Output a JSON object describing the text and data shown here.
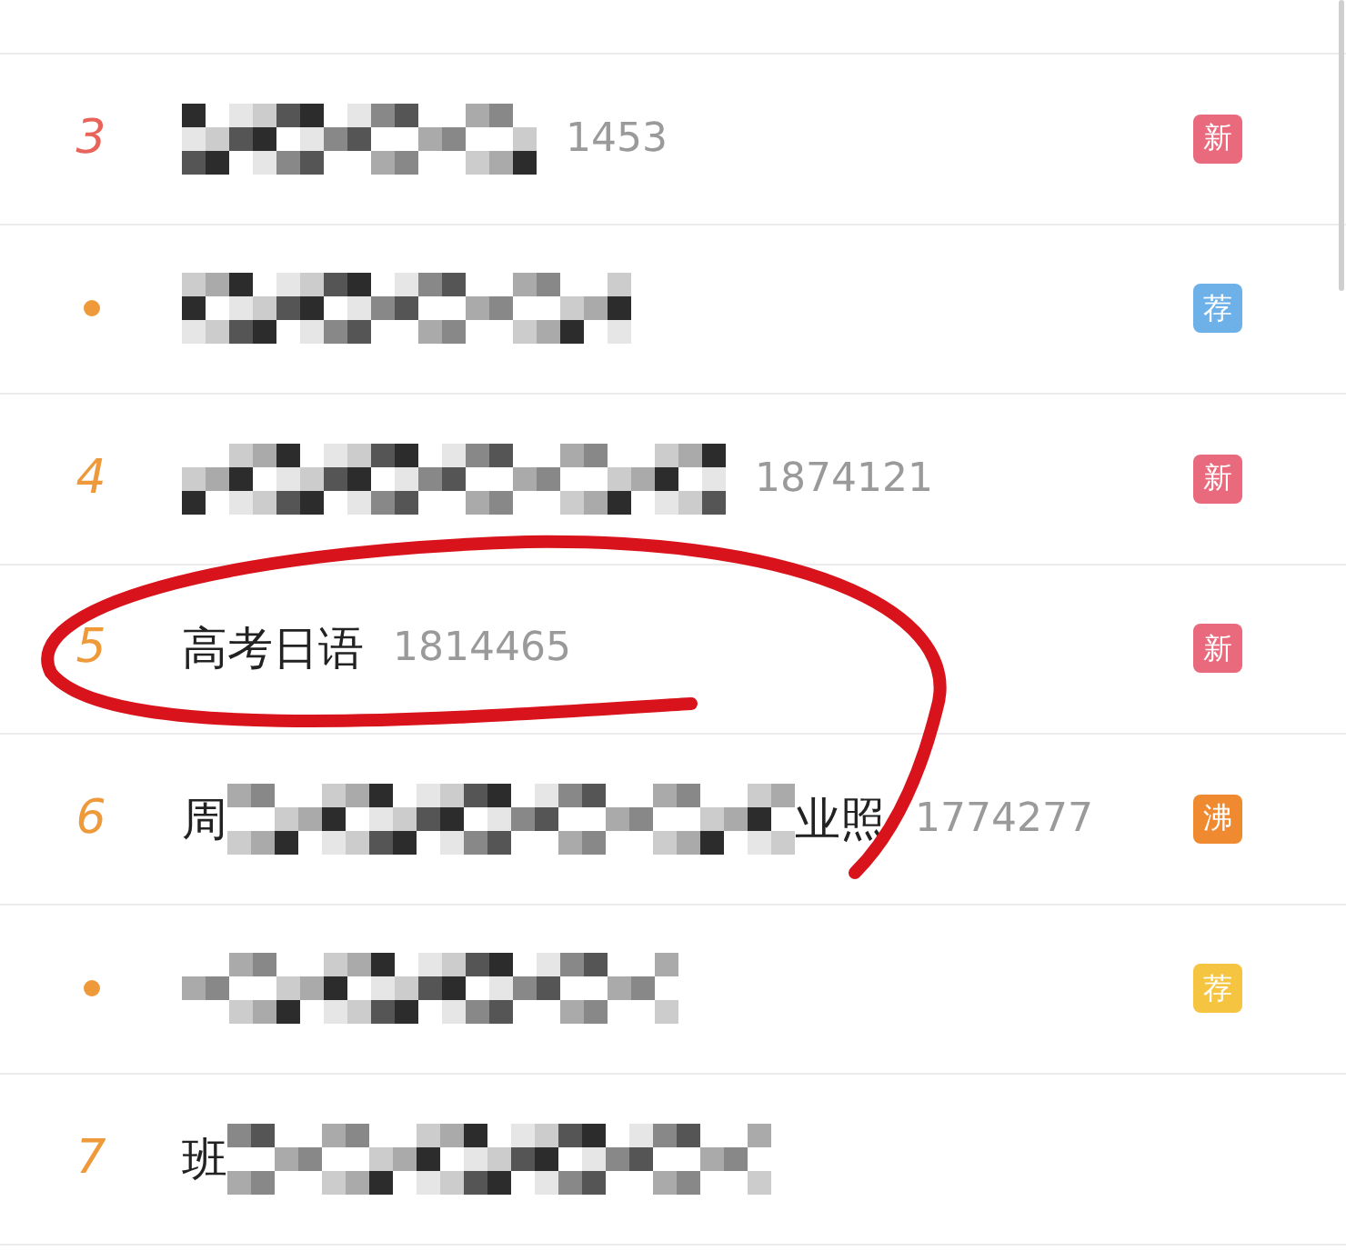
{
  "rows": [
    {
      "kind": "number",
      "rank": "3",
      "color": "#e8635a",
      "redacted": true,
      "heat": "1453",
      "badge": {
        "label": "新",
        "color": "#e9697d"
      }
    },
    {
      "kind": "dot",
      "color": "#ee9a3a",
      "redacted": true,
      "badge": {
        "label": "荐",
        "color": "#6eb0e8"
      }
    },
    {
      "kind": "number",
      "rank": "4",
      "color": "#ee9a3a",
      "redacted": true,
      "heat": "1874121",
      "badge": {
        "label": "新",
        "color": "#e9697d"
      }
    },
    {
      "kind": "number",
      "rank": "5",
      "color": "#ee9a3a",
      "redacted": false,
      "title_start": "高考日语",
      "heat": "1814465",
      "badge": {
        "label": "新",
        "color": "#e9697d"
      }
    },
    {
      "kind": "number",
      "rank": "6",
      "color": "#ee9a3a",
      "redacted": true,
      "title_start": "周",
      "title_end": "业照",
      "heat": "1774277",
      "badge": {
        "label": "沸",
        "color": "#f08a30"
      }
    },
    {
      "kind": "dot",
      "color": "#ee9a3a",
      "redacted": true,
      "badge": {
        "label": "荐",
        "color": "#f5c542"
      }
    },
    {
      "kind": "number",
      "rank": "7",
      "color": "#ee9a3a",
      "redacted": true,
      "title_start": "班"
    }
  ]
}
